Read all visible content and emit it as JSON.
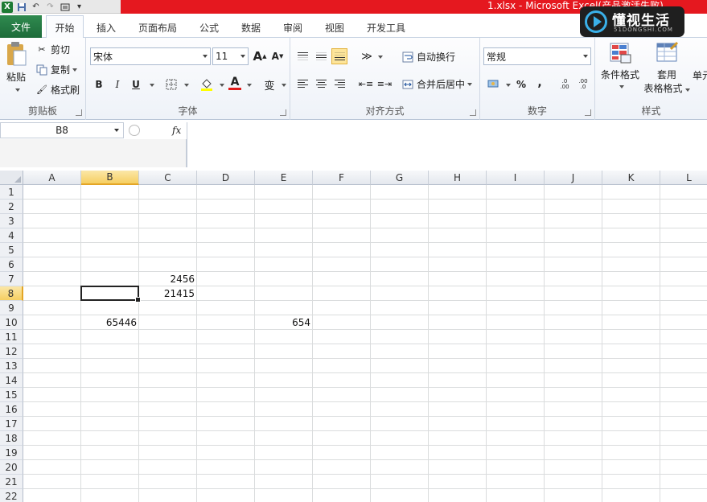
{
  "window": {
    "title": "1.xlsx - Microsoft Excel(产品激活失败)"
  },
  "quick_access": {
    "app_icon": "X",
    "save_icon": "save-icon",
    "undo_icon": "undo-icon",
    "redo_icon": "redo-icon"
  },
  "watermark": {
    "text": "懂视生活",
    "subtext": "51DONGSHI.COM"
  },
  "tabs": {
    "file": "文件",
    "items": [
      "开始",
      "插入",
      "页面布局",
      "公式",
      "数据",
      "审阅",
      "视图",
      "开发工具"
    ],
    "active": "开始"
  },
  "ribbon": {
    "clipboard": {
      "label": "剪贴板",
      "paste": "粘贴",
      "cut": "剪切",
      "copy": "复制",
      "format_painter": "格式刷"
    },
    "font": {
      "label": "字体",
      "font_name": "宋体",
      "font_size": "11",
      "grow": "A",
      "shrink": "A",
      "bold": "B",
      "italic": "I",
      "underline": "U",
      "font_color": "A",
      "phonetic": "wén"
    },
    "alignment": {
      "label": "对齐方式",
      "wrap_text": "自动换行",
      "merge_center": "合并后居中"
    },
    "number": {
      "label": "数字",
      "format": "常规",
      "percent": "%",
      "comma": ",",
      "inc_decimal": ".0 .00",
      "dec_decimal": ".00 .0"
    },
    "styles": {
      "label": "样式",
      "conditional": "条件格式",
      "table_format_1": "套用",
      "table_format_2": "表格格式",
      "cell_styles": "单元"
    }
  },
  "formula_bar": {
    "name_box": "B8",
    "fx": "fx",
    "value": ""
  },
  "sheet": {
    "columns": [
      "A",
      "B",
      "C",
      "D",
      "E",
      "F",
      "G",
      "H",
      "I",
      "J",
      "K",
      "L"
    ],
    "rows": [
      "1",
      "2",
      "3",
      "4",
      "5",
      "6",
      "7",
      "8",
      "9",
      "10",
      "11",
      "12",
      "13",
      "14",
      "15",
      "16",
      "17",
      "18",
      "19",
      "20",
      "21",
      "22"
    ],
    "selected_column": "B",
    "selected_row": "8",
    "cells": {
      "C7": "2456",
      "C8": "21415",
      "B10": "65446",
      "E10": "654"
    }
  }
}
